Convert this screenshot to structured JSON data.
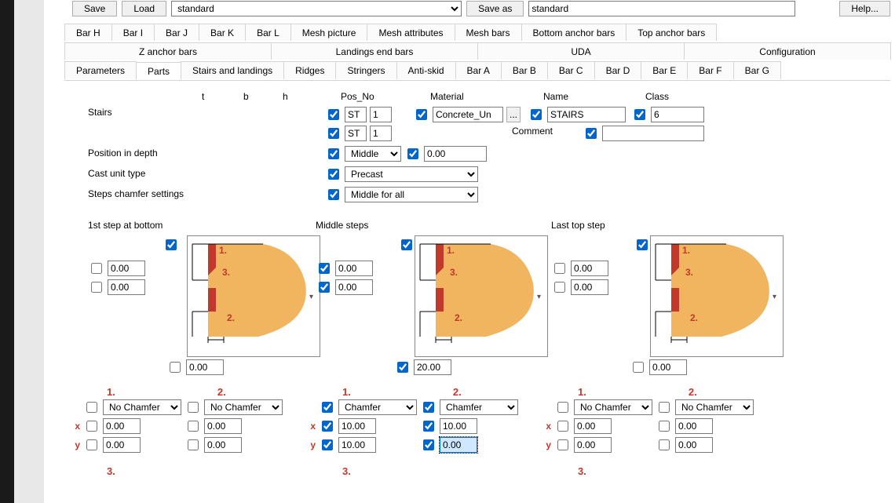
{
  "buttons": {
    "save": "Save",
    "load": "Load",
    "saveas": "Save as",
    "help": "Help..."
  },
  "preset_left": "standard",
  "preset_right": "standard",
  "tabs_row1": [
    "Bar H",
    "Bar I",
    "Bar J",
    "Bar K",
    "Bar L",
    "Mesh picture",
    "Mesh attributes",
    "Mesh bars",
    "Bottom anchor bars",
    "Top anchor bars"
  ],
  "tabs_row2": [
    "Z anchor bars",
    "Landings end bars",
    "UDA",
    "Configuration"
  ],
  "tabs_row3": [
    "Parameters",
    "Parts",
    "Stairs and landings",
    "Ridges",
    "Stringers",
    "Anti-skid",
    "Bar A",
    "Bar B",
    "Bar C",
    "Bar D",
    "Bar E",
    "Bar F",
    "Bar G"
  ],
  "active_tab": "Parts",
  "cols": {
    "t": "t",
    "b": "b",
    "h": "h",
    "posno": "Pos_No",
    "material": "Material",
    "name": "Name",
    "class": "Class",
    "comment": "Comment"
  },
  "labels": {
    "stairs": "Stairs",
    "pos_depth": "Position in depth",
    "cast": "Cast unit type",
    "chamfer": "Steps chamfer settings",
    "first": "1st step at bottom",
    "middle": "Middle steps",
    "last": "Last top step"
  },
  "top": {
    "st1": "ST",
    "st1n": "1",
    "st2": "ST",
    "st2n": "1",
    "material": "Concrete_Un",
    "name": "STAIRS",
    "class": "6",
    "comment": "",
    "posdepth": "Middle",
    "posdepth_v": "0.00",
    "cast": "Precast",
    "chamfer": "Middle for all"
  },
  "step1": {
    "v1": "0.00",
    "v2": "0.00",
    "v3": "0.00",
    "c1": "No Chamfer",
    "c2": "No Chamfer",
    "x1": "0.00",
    "y1": "0.00",
    "x2": "0.00",
    "y2": "0.00"
  },
  "step2": {
    "v1": "0.00",
    "v2": "0.00",
    "v3": "20.00",
    "c1": "Chamfer",
    "c2": "Chamfer",
    "x1": "10.00",
    "y1": "10.00",
    "x2": "10.00",
    "y2": "0.00"
  },
  "step3": {
    "v1": "0.00",
    "v2": "0.00",
    "v3": "0.00",
    "c1": "No Chamfer",
    "c2": "No Chamfer",
    "x1": "0.00",
    "y1": "0.00",
    "x2": "0.00",
    "y2": "0.00"
  },
  "hdr3": "3."
}
